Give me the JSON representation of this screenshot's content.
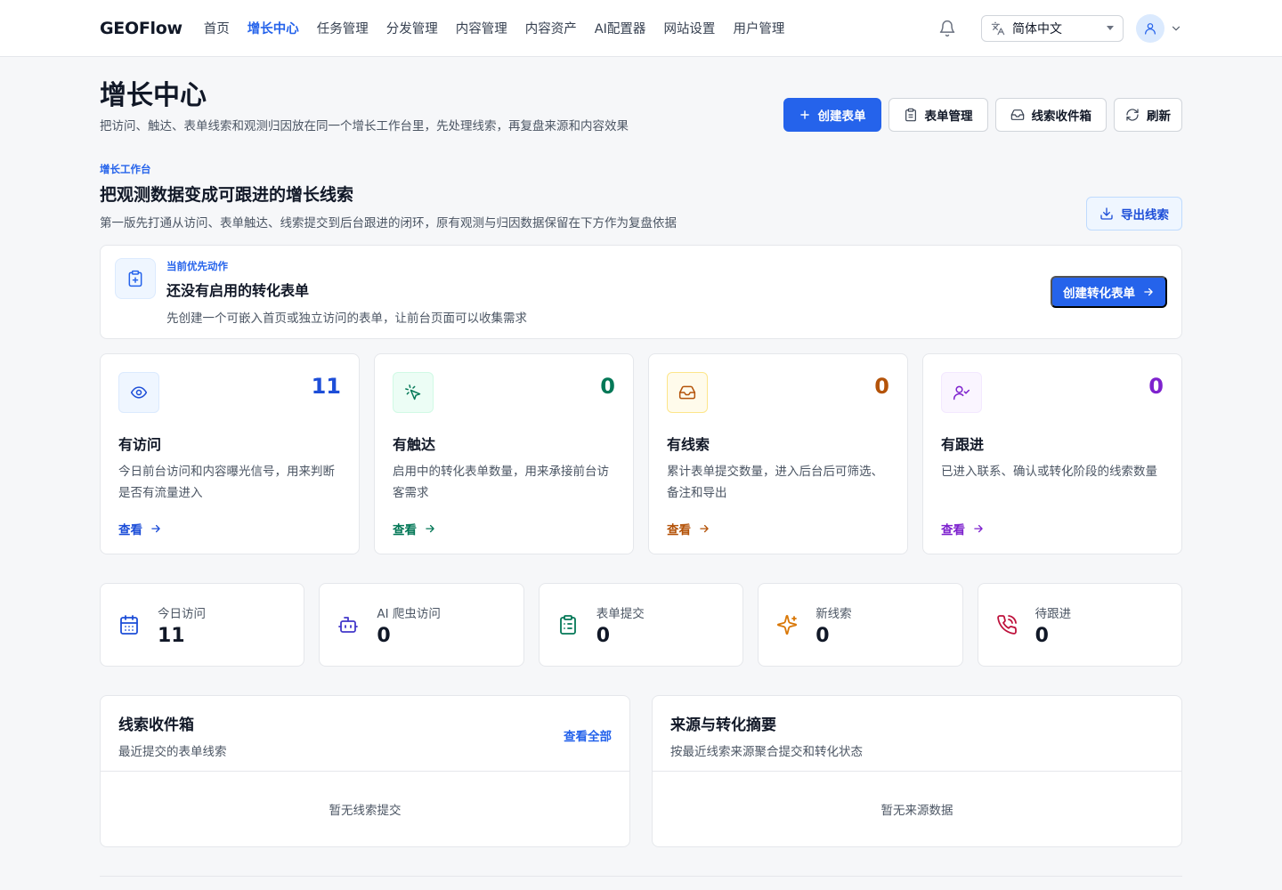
{
  "brand": "GEOFlow",
  "nav": [
    "首页",
    "增长中心",
    "任务管理",
    "分发管理",
    "内容管理",
    "内容资产",
    "AI配置器",
    "网站设置",
    "用户管理"
  ],
  "language": "简体中文",
  "page": {
    "title": "增长中心",
    "desc": "把访问、触达、表单线索和观测归因放在同一个增长工作台里，先处理线索，再复盘来源和内容效果"
  },
  "actions": {
    "create_form": "创建表单",
    "form_manage": "表单管理",
    "lead_inbox": "线索收件箱",
    "refresh": "刷新"
  },
  "workbench": {
    "eyebrow": "增长工作台",
    "title": "把观测数据变成可跟进的增长线索",
    "desc": "第一版先打通从访问、表单触达、线索提交到后台跟进的闭环，原有观测与归因数据保留在下方作为复盘依据",
    "export": "导出线索"
  },
  "priority": {
    "eyebrow": "当前优先动作",
    "title": "还没有启用的转化表单",
    "desc": "先创建一个可嵌入首页或独立访问的表单，让前台页面可以收集需求",
    "button": "创建转化表单"
  },
  "cards": [
    {
      "title": "有访问",
      "value": "11",
      "desc": "今日前台访问和内容曝光信号，用来判断是否有流量进入",
      "link": "查看",
      "color": "#1d4ed8",
      "bg": "#eff6ff",
      "border": "#dbeafe",
      "icon": "eye-icon"
    },
    {
      "title": "有触达",
      "value": "0",
      "desc": "启用中的转化表单数量，用来承接前台访客需求",
      "link": "查看",
      "color": "#047857",
      "bg": "#ecfdf5",
      "border": "#d1fae5",
      "icon": "cursor-click-icon"
    },
    {
      "title": "有线索",
      "value": "0",
      "desc": "累计表单提交数量，进入后台后可筛选、备注和导出",
      "link": "查看",
      "color": "#b45309",
      "bg": "#fffbeb",
      "border": "#fde68a",
      "icon": "inbox-icon"
    },
    {
      "title": "有跟进",
      "value": "0",
      "desc": "已进入联系、确认或转化阶段的线索数量",
      "link": "查看",
      "color": "#7e22ce",
      "bg": "#faf5ff",
      "border": "#f3e8ff",
      "icon": "user-check-icon"
    }
  ],
  "stats": [
    {
      "label": "今日访问",
      "value": "11",
      "color": "#1d4ed8",
      "icon": "calendar-icon"
    },
    {
      "label": "AI 爬虫访问",
      "value": "0",
      "color": "#4338ca",
      "icon": "robot-icon"
    },
    {
      "label": "表单提交",
      "value": "0",
      "color": "#047857",
      "icon": "clipboard-list-icon"
    },
    {
      "label": "新线索",
      "value": "0",
      "color": "#d97706",
      "icon": "sparkles-icon"
    },
    {
      "label": "待跟进",
      "value": "0",
      "color": "#be123c",
      "icon": "phone-icon"
    }
  ],
  "panels": {
    "inbox": {
      "title": "线索收件箱",
      "desc": "最近提交的表单线索",
      "link": "查看全部",
      "empty": "暂无线索提交"
    },
    "sources": {
      "title": "来源与转化摘要",
      "desc": "按最近线索来源聚合提交和转化状态",
      "empty": "暂无来源数据"
    }
  }
}
